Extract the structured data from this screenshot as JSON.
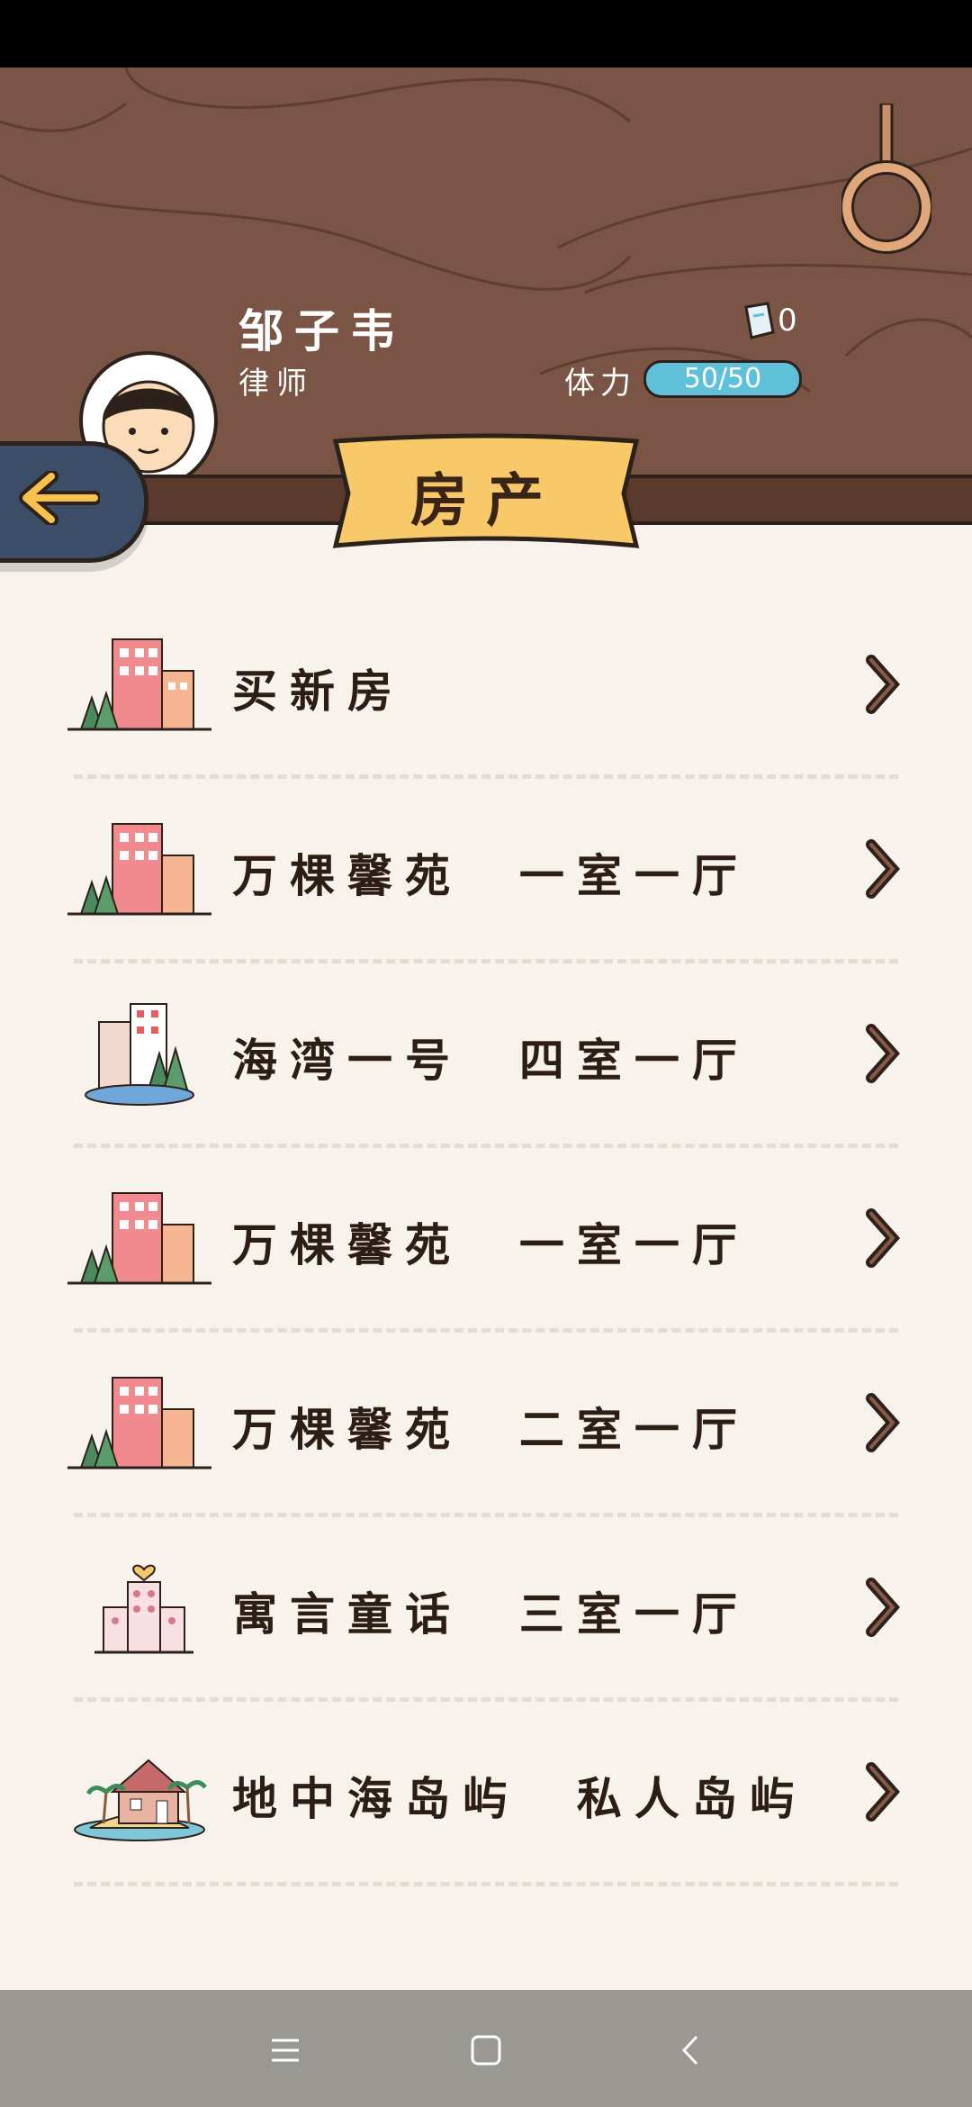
{
  "profile": {
    "name": "邹子韦",
    "job": "律师",
    "tickets": "0",
    "stamina_label": "体力",
    "stamina_value": "50/50"
  },
  "page": {
    "title": "房产"
  },
  "properties": [
    {
      "label": "买新房",
      "icon": "pink-apartment-trees-icon"
    },
    {
      "label": "万棵馨苑  一室一厅",
      "icon": "pink-apartment-trees-icon"
    },
    {
      "label": "海湾一号  四室一厅",
      "icon": "bay-building-lake-icon"
    },
    {
      "label": "万棵馨苑  一室一厅",
      "icon": "pink-apartment-trees-icon"
    },
    {
      "label": "万棵馨苑  二室一厅",
      "icon": "pink-apartment-trees-icon"
    },
    {
      "label": "寓言童话  三室一厅",
      "icon": "fairytale-building-heart-icon"
    },
    {
      "label": "地中海岛屿  私人岛屿",
      "icon": "island-house-palm-icon"
    }
  ],
  "colors": {
    "header_bg": "#7a5444",
    "page_bg": "#f7f3ec",
    "stamina_fill": "#5fc0da",
    "banner": "#f8c969",
    "back_button": "#3c4d67"
  }
}
